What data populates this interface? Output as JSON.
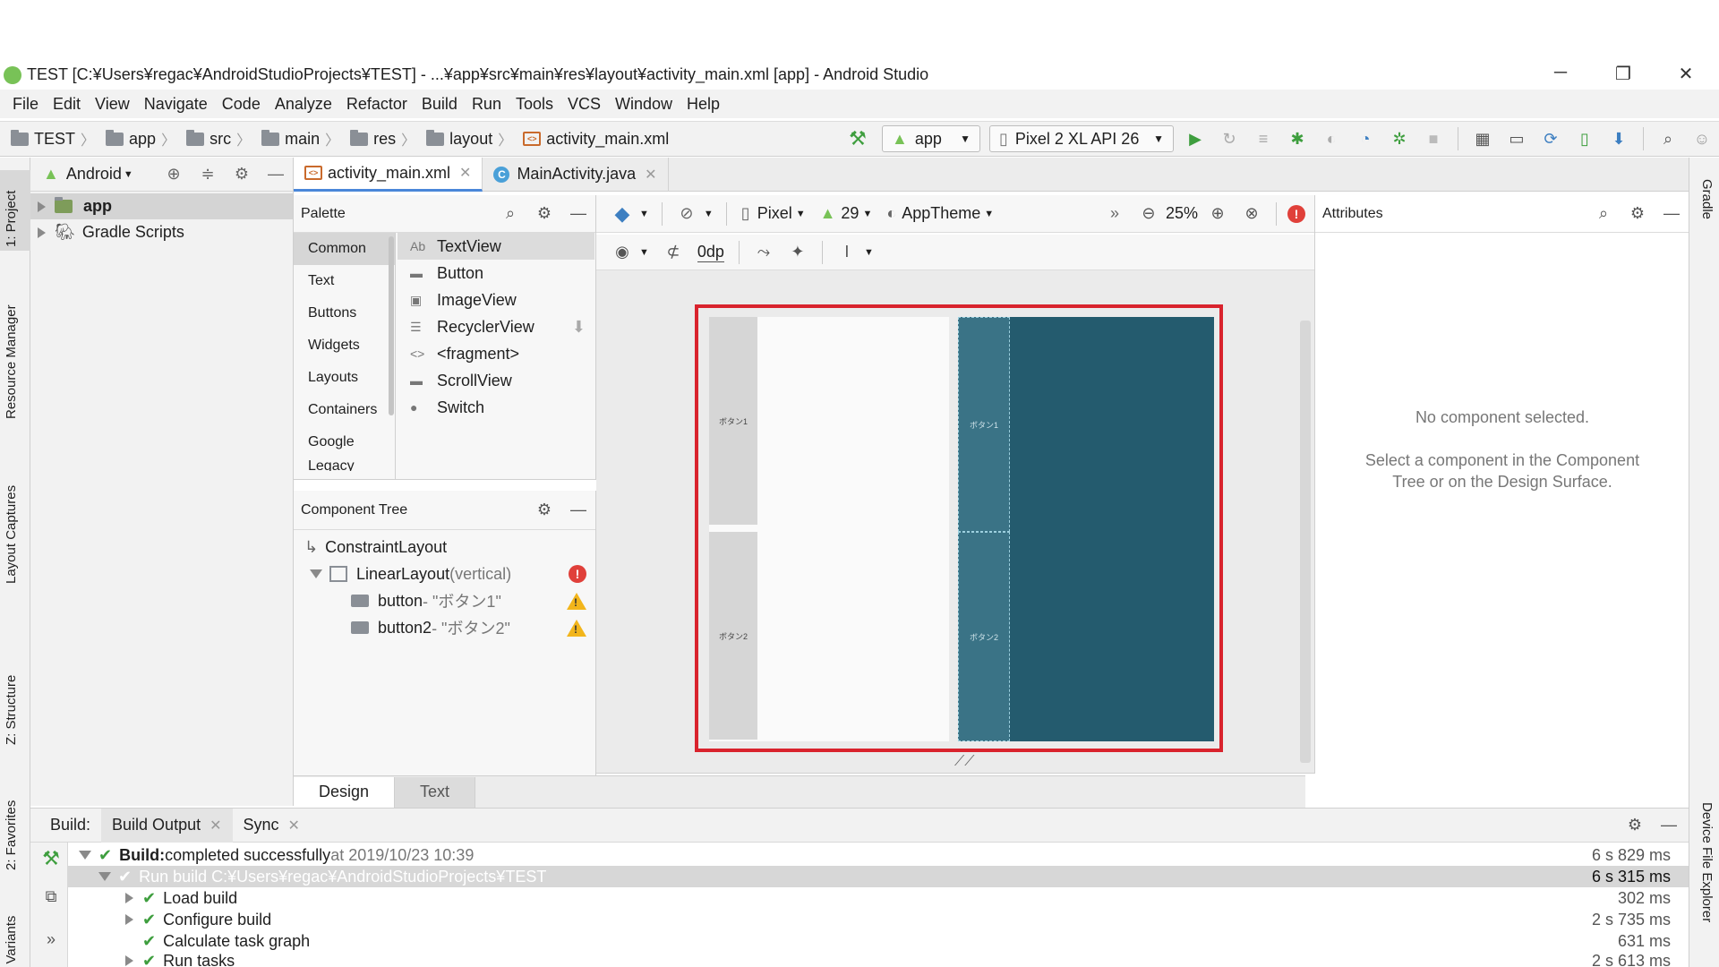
{
  "window": {
    "title": "TEST [C:¥Users¥regac¥AndroidStudioProjects¥TEST] - ...¥app¥src¥main¥res¥layout¥activity_main.xml [app] - Android Studio",
    "minimize": "─",
    "restore": "❐",
    "close": "✕"
  },
  "menu": [
    "File",
    "Edit",
    "View",
    "Navigate",
    "Code",
    "Analyze",
    "Refactor",
    "Build",
    "Run",
    "Tools",
    "VCS",
    "Window",
    "Help"
  ],
  "breadcrumbs": [
    "TEST",
    "app",
    "src",
    "main",
    "res",
    "layout",
    "activity_main.xml"
  ],
  "toolbar": {
    "run_config": "app",
    "device": "Pixel 2 XL API 26"
  },
  "left_strip": {
    "project": "1: Project",
    "resource_manager": "Resource Manager",
    "layout_captures": "Layout Captures",
    "structure": "Z: Structure",
    "favorites": "2: Favorites",
    "build_variants": "Build Variants"
  },
  "right_strip": {
    "gradle": "Gradle",
    "device_file_explorer": "Device File Explorer"
  },
  "project_panel": {
    "view_mode": "Android",
    "items": [
      {
        "label": "app",
        "bold": true
      },
      {
        "label": "Gradle Scripts",
        "bold": false
      }
    ]
  },
  "editor_tabs": [
    {
      "label": "activity_main.xml",
      "active": true
    },
    {
      "label": "MainActivity.java",
      "active": false
    }
  ],
  "palette": {
    "title": "Palette",
    "categories": [
      "Common",
      "Text",
      "Buttons",
      "Widgets",
      "Layouts",
      "Containers",
      "Google",
      "Legacy"
    ],
    "items": [
      {
        "icon": "Ab",
        "label": "TextView"
      },
      {
        "icon": "▬",
        "label": "Button"
      },
      {
        "icon": "▣",
        "label": "ImageView"
      },
      {
        "icon": "☰",
        "label": "RecyclerView"
      },
      {
        "icon": "<>",
        "label": "<fragment>"
      },
      {
        "icon": "▬",
        "label": "ScrollView"
      },
      {
        "icon": "●",
        "label": "Switch"
      }
    ]
  },
  "component_tree": {
    "title": "Component Tree",
    "root": "ConstraintLayout",
    "linear_layout": {
      "name": "LinearLayout",
      "qualifier": "(vertical)"
    },
    "buttons": [
      {
        "id": "button",
        "text": "- \"ボタン1\""
      },
      {
        "id": "button2",
        "text": "- \"ボタン2\""
      }
    ]
  },
  "design_toolbar": {
    "device": "Pixel",
    "api": "29",
    "theme": "AppTheme",
    "zoom": "25%",
    "margin": "0dp"
  },
  "preview": {
    "button1": "ボタン1",
    "button2": "ボタン2"
  },
  "bottom_tabs": {
    "design": "Design",
    "text": "Text"
  },
  "attributes": {
    "title": "Attributes",
    "empty_title": "No component selected.",
    "empty_hint_1": "Select a component in the Component",
    "empty_hint_2": "Tree or on the Design Surface."
  },
  "build": {
    "label": "Build:",
    "tabs": [
      "Build Output",
      "Sync"
    ],
    "rows": [
      {
        "label_bold": "Build:",
        "label": " completed successfully",
        "suffix": " at 2019/10/23 10:39",
        "time": "6 s 829 ms"
      },
      {
        "label": "Run build C:¥Users¥regac¥AndroidStudioProjects¥TEST",
        "time": "6 s 315 ms"
      },
      {
        "label": "Load build",
        "time": "302 ms"
      },
      {
        "label": "Configure build",
        "time": "2 s 735 ms"
      },
      {
        "label": "Calculate task graph",
        "time": "631 ms"
      },
      {
        "label": "Run tasks",
        "time": "2 s 613 ms"
      }
    ]
  },
  "colors": {
    "accent": "#4a87d9",
    "error": "#e0403a",
    "warning": "#f2b51b",
    "success": "#3e9e3e",
    "selection_frame": "#d9232d",
    "blueprint": "#245b6e"
  }
}
